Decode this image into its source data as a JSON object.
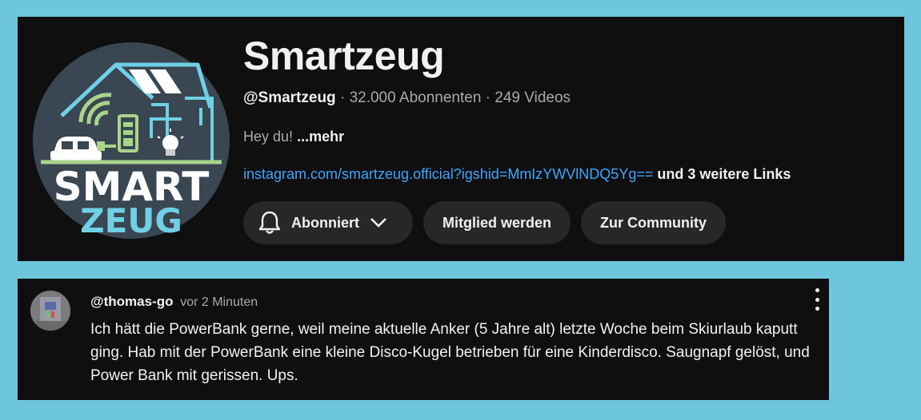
{
  "channel": {
    "title": "Smartzeug",
    "handle": "@Smartzeug",
    "subscribers": "32.000 Abonnenten",
    "videos": "249 Videos",
    "separator": " · ",
    "description": "Hey du!",
    "description_more": "...mehr",
    "link": "instagram.com/smartzeug.official?igshid=MmIzYWVlNDQ5Yg==",
    "more_links": "und 3 weitere Links",
    "logo": {
      "line1": "SMART",
      "line2": "ZEUG"
    }
  },
  "buttons": {
    "subscribed": "Abonniert",
    "join": "Mitglied werden",
    "community": "Zur Community"
  },
  "comment": {
    "author": "@thomas-go",
    "time": "vor 2 Minuten",
    "text": "Ich hätt die PowerBank gerne, weil meine aktuelle Anker (5 Jahre alt) letzte Woche beim Skiurlaub kaputt ging. Hab mit der PowerBank eine kleine Disco-Kugel betrieben für eine Kinderdisco. Saugnapf gelöst, und Power Bank mit gerissen. Ups."
  },
  "icons": {
    "bell": "bell-icon",
    "chevron": "chevron-down-icon",
    "kebab": "more-vert-icon"
  },
  "colors": {
    "page_background": "#6ec6dd",
    "card_background": "#0f0f0f",
    "link": "#3ea6ff",
    "button_background": "#272727"
  }
}
